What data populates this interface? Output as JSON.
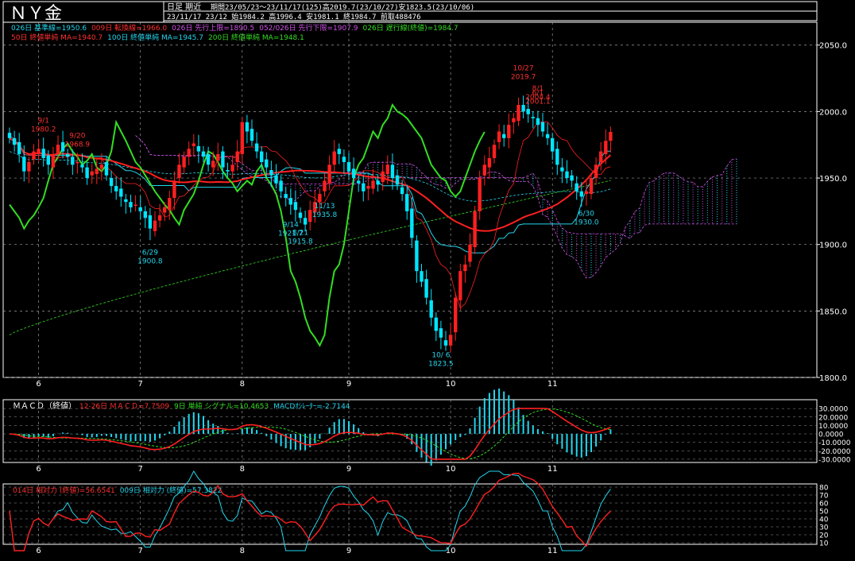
{
  "header": {
    "title": "ＮＹ金",
    "mode": "日足 期近",
    "line1": "期間23/05/23～23/11/17(125)高2019.7(23/10/27)安1823.5(23/10/06)",
    "line2": "23/11/17 23/12 始1984.2 高1996.4 安1981.1 終1984.7 前取488476"
  },
  "colors": {
    "bg": "#000000",
    "grid": "#9a9a9a",
    "up": "#ff2020",
    "down": "#00e5ff",
    "red_line": "#ff2020",
    "green": "#33dd22",
    "cyan": "#22d6ee",
    "magenta": "#d050e8",
    "white": "#ffffff"
  },
  "legend": {
    "row1": [
      {
        "text": "026日 基準線=1950.6",
        "color": "#22d6ee"
      },
      {
        "text": "009日 転換線=1966.0",
        "color": "#ff3030"
      },
      {
        "text": "026日 先行上限=1890.5",
        "color": "#d050e8"
      },
      {
        "text": "052/026日 先行下限=1907.9",
        "color": "#d050e8"
      },
      {
        "text": "026日 遅行線(終値)=1984.7",
        "color": "#33dd22"
      }
    ],
    "row2": [
      {
        "text": "50日 終値単純 MA=1940.7",
        "color": "#ff3030"
      },
      {
        "text": "100日 終値単純 MA=1945.7",
        "color": "#22d6ee"
      },
      {
        "text": "200日 終値単純 MA=1948.1",
        "color": "#33dd22"
      }
    ]
  },
  "main": {
    "y_ticks": [
      "2050.0",
      "2000.0",
      "1950.0",
      "1900.0",
      "1850.0",
      "1800.0"
    ],
    "y_values": [
      2050,
      2000,
      1950,
      1900,
      1850,
      1800
    ],
    "y_range": [
      1800,
      2060
    ],
    "annotations": [
      {
        "date": "6/1",
        "value": "2001.1",
        "anchor": 2001.1,
        "color": "#ff3030",
        "pos": "above"
      },
      {
        "date": "8/1",
        "value": "2004.4",
        "anchor": 2004.4,
        "color": "#ff3030",
        "pos": "above"
      },
      {
        "date": "9/1",
        "value": "1980.2",
        "anchor": 1980.2,
        "color": "#ff3030",
        "pos": "above"
      },
      {
        "date": "9/20",
        "value": "1968.9",
        "anchor": 1968.9,
        "color": "#ff3030",
        "pos": "above"
      },
      {
        "date": "10/27",
        "value": "2019.7",
        "anchor": 2019.7,
        "color": "#ff3030",
        "pos": "above"
      },
      {
        "date": "6/30",
        "value": "1930.0",
        "anchor": 1930.0,
        "color": "#22d6ee",
        "pos": "below"
      },
      {
        "date": "6/29",
        "value": "1900.8",
        "anchor": 1900.8,
        "color": "#22d6ee",
        "pos": "below"
      },
      {
        "date": "8/21",
        "value": "1915.8",
        "anchor": 1915.8,
        "color": "#22d6ee",
        "pos": "below"
      },
      {
        "date": "9/14",
        "value": "1921.7",
        "anchor": 1921.7,
        "color": "#22d6ee",
        "pos": "below"
      },
      {
        "date": "10/ 6",
        "value": "1823.5",
        "anchor": 1823.5,
        "color": "#22d6ee",
        "pos": "below"
      },
      {
        "date": "11/13",
        "value": "1935.8",
        "anchor": 1935.8,
        "color": "#22d6ee",
        "pos": "below"
      }
    ]
  },
  "macd": {
    "title": "ＭＡＣＤ（終値）",
    "legend": [
      {
        "text": "12-26日 ＭＡＣＤ=7.7509",
        "color": "#ff3030"
      },
      {
        "text": "9日 単純 シグナル=10.4653",
        "color": "#33dd22"
      },
      {
        "text": "MACDｵｼﾚｰﾀｰ=-2.7144",
        "color": "#22d6ee"
      }
    ],
    "y_ticks": [
      "30.0000",
      "20.0000",
      "10.0000",
      "0.0000",
      "-10.0000",
      "-20.0000",
      "-30.0000"
    ],
    "y_values": [
      30,
      20,
      10,
      0,
      -10,
      -20,
      -30
    ],
    "y_range": [
      -32,
      32
    ]
  },
  "rsi": {
    "legend": [
      {
        "text": "014日 相対力 (終値)=56.6541",
        "color": "#ff3030"
      },
      {
        "text": "009日 相対力 (終値)=57.3822",
        "color": "#22d6ee"
      }
    ],
    "y_ticks": [
      "80",
      "70",
      "60",
      "50",
      "40",
      "30",
      "20",
      "10"
    ],
    "y_values": [
      80,
      70,
      60,
      50,
      40,
      30,
      20,
      10
    ],
    "y_range": [
      8,
      82
    ]
  },
  "x_axis": {
    "labels": [
      "6",
      "7",
      "8",
      "9",
      "10",
      "11"
    ],
    "label_index": [
      6,
      27,
      48,
      70,
      91,
      112
    ]
  },
  "chart_data": {
    "type": "candlestick",
    "period": "23/05/23～23/11/17",
    "bars": 125,
    "high": {
      "value": 2019.7,
      "date": "23/10/27"
    },
    "low": {
      "value": 1823.5,
      "date": "23/10/06"
    },
    "closes": [
      1980,
      1975,
      1968,
      1955,
      1962,
      1970,
      1972,
      1965,
      1960,
      1968,
      1975,
      1970,
      1966,
      1960,
      1962,
      1958,
      1950,
      1955,
      1957,
      1960,
      1952,
      1944,
      1940,
      1936,
      1932,
      1928,
      1930,
      1925,
      1920,
      1912,
      1918,
      1922,
      1928,
      1935,
      1948,
      1960,
      1966,
      1972,
      1976,
      1970,
      1966,
      1960,
      1963,
      1968,
      1958,
      1955,
      1960,
      1970,
      1992,
      1985,
      1978,
      1970,
      1962,
      1958,
      1952,
      1946,
      1940,
      1935,
      1930,
      1926,
      1920,
      1915,
      1926,
      1932,
      1938,
      1948,
      1960,
      1970,
      1968,
      1962,
      1955,
      1950,
      1946,
      1940,
      1944,
      1948,
      1945,
      1955,
      1960,
      1950,
      1945,
      1938,
      1925,
      1905,
      1880,
      1872,
      1860,
      1845,
      1835,
      1830,
      1824,
      1832,
      1860,
      1880,
      1885,
      1900,
      1925,
      1950,
      1960,
      1965,
      1975,
      1985,
      1980,
      1990,
      1995,
      2005,
      2000,
      1998,
      1995,
      1990,
      1985,
      1980,
      1970,
      1960,
      1955,
      1950,
      1948,
      1940,
      1936,
      1940,
      1950,
      1960,
      1970,
      1978,
      1984.7
    ],
    "ma50_final": 1940.7,
    "ma100_final": 1945.7,
    "ma200_final": 1948.1,
    "kijun_final": 1950.6,
    "tenkan_final": 1966.0,
    "macd_final": 7.7509,
    "signal_final": 10.4653,
    "oscillator_final": -2.7144,
    "rsi14_final": 56.6541,
    "rsi9_final": 57.3822
  }
}
